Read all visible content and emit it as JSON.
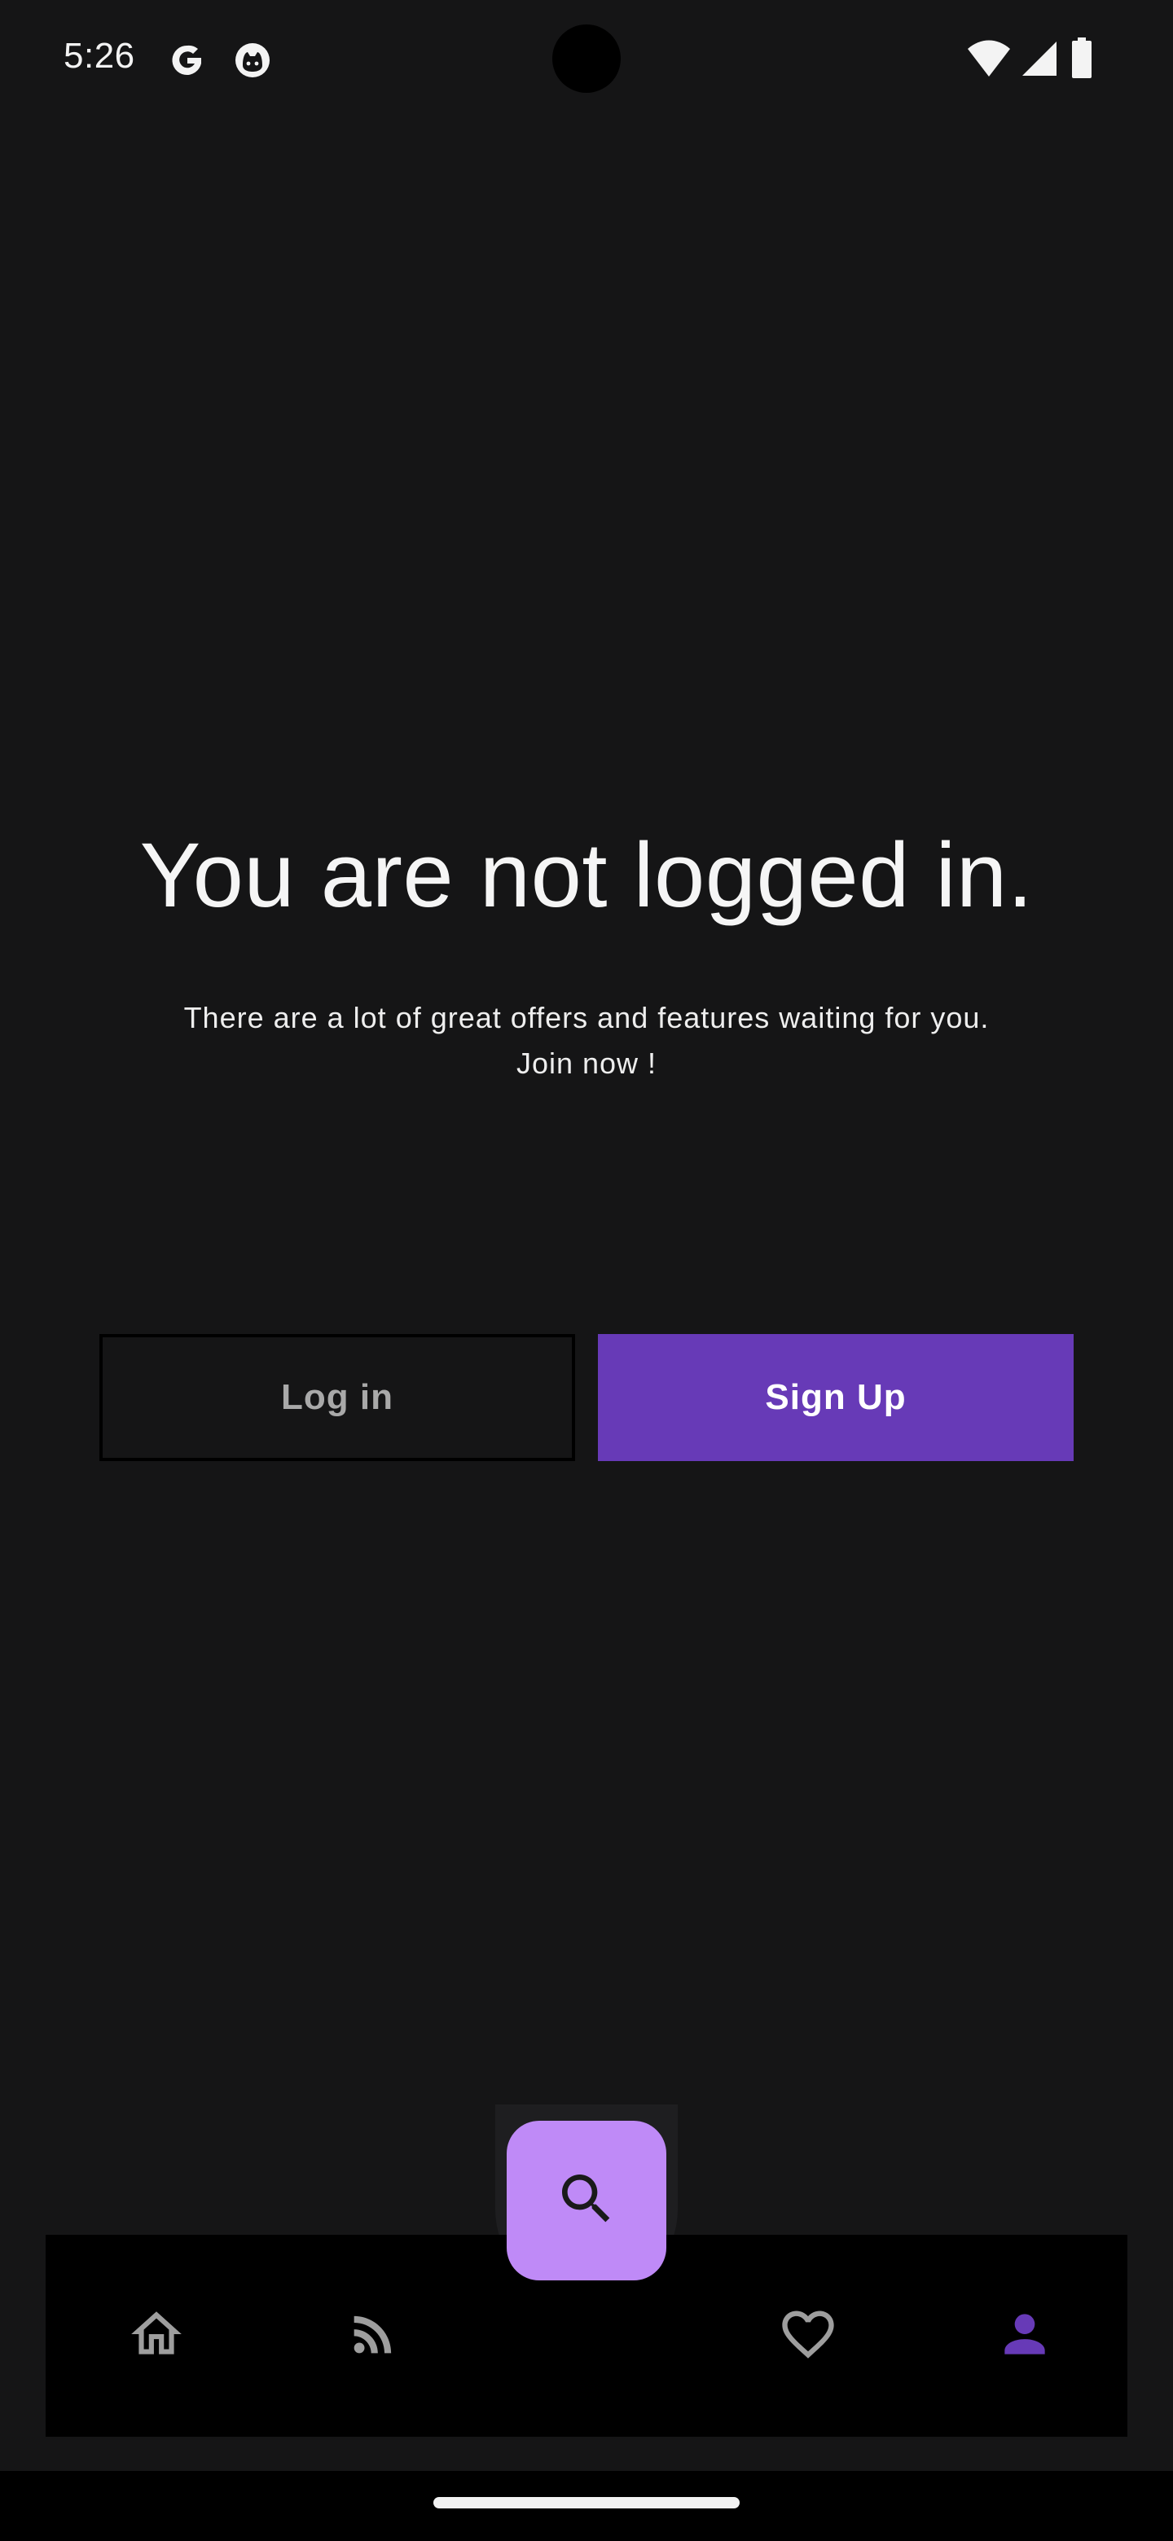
{
  "status_bar": {
    "time": "5:26",
    "icons": [
      "google-icon",
      "cat-face-icon",
      "wifi-icon",
      "cellular-signal-icon",
      "battery-icon"
    ]
  },
  "main": {
    "headline": "You are not logged in.",
    "subtext": "There are a lot of great offers and features waiting for you.\nJoin now !",
    "login_label": "Log in",
    "signup_label": "Sign Up"
  },
  "bottom_nav": {
    "items": [
      {
        "icon": "home-icon",
        "active": false
      },
      {
        "icon": "rss-feed-icon",
        "active": false
      },
      {
        "icon": "favorites-heart-icon",
        "active": false
      },
      {
        "icon": "profile-person-icon",
        "active": true
      }
    ],
    "fab_icon": "search-icon"
  },
  "colors": {
    "background": "#151516",
    "accent": "#673ab7",
    "fab": "#bf8af7",
    "nav_background": "#000000",
    "inactive_icon": "#9e9e9e",
    "active_icon": "#673ab7"
  }
}
